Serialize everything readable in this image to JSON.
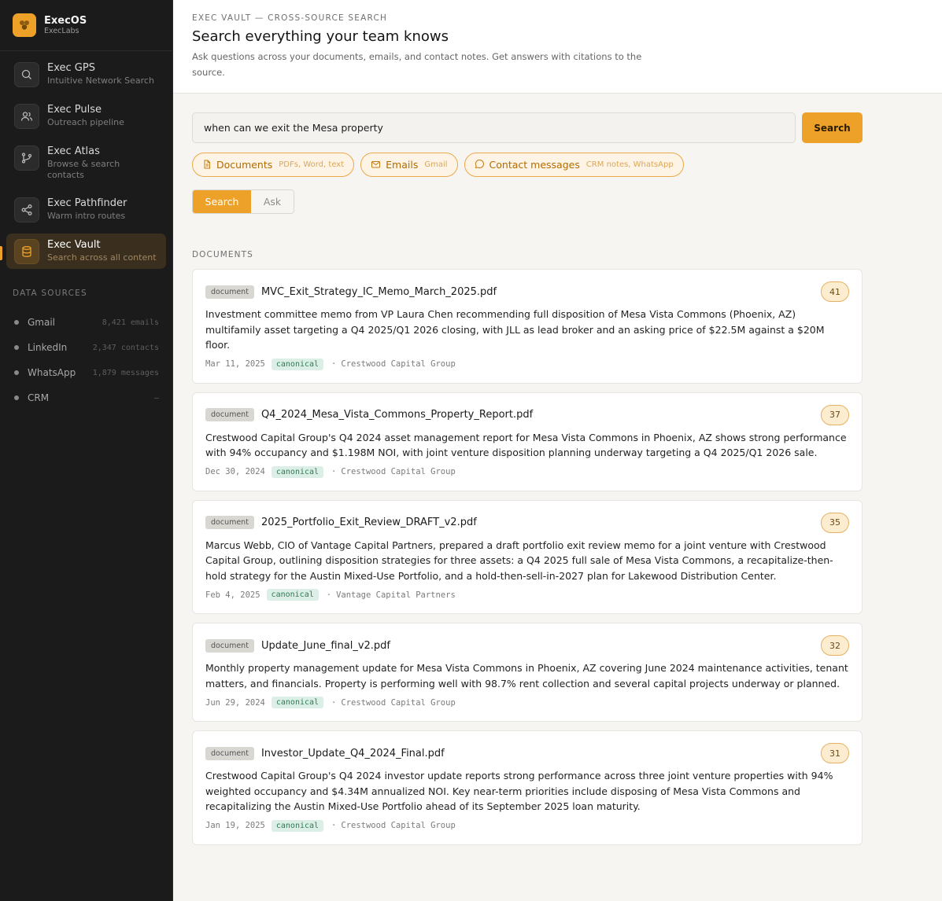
{
  "brand": {
    "name": "ExecOS",
    "org": "ExecLabs"
  },
  "nav": [
    {
      "title": "Exec GPS",
      "desc": "Intuitive Network Search",
      "icon": "search-icon"
    },
    {
      "title": "Exec Pulse",
      "desc": "Outreach pipeline",
      "icon": "users-icon"
    },
    {
      "title": "Exec Atlas",
      "desc": "Browse & search contacts",
      "icon": "git-branch-icon"
    },
    {
      "title": "Exec Pathfinder",
      "desc": "Warm intro routes",
      "icon": "share-icon"
    },
    {
      "title": "Exec Vault",
      "desc": "Search across all content",
      "icon": "database-icon",
      "active": true
    }
  ],
  "data_sources": {
    "heading": "DATA SOURCES",
    "items": [
      {
        "name": "Gmail",
        "count": "8,421 emails"
      },
      {
        "name": "LinkedIn",
        "count": "2,347 contacts"
      },
      {
        "name": "WhatsApp",
        "count": "1,879 messages"
      },
      {
        "name": "CRM",
        "count": "—"
      }
    ]
  },
  "header": {
    "eyebrow": "EXEC VAULT — CROSS-SOURCE SEARCH",
    "title": "Search everything your team knows",
    "subtitle": "Ask questions across your documents, emails, and contact notes. Get answers with citations to the source."
  },
  "search": {
    "value": "when can we exit the Mesa property",
    "button": "Search"
  },
  "filters": [
    {
      "label": "Documents",
      "hint": "PDFs, Word, text",
      "icon": "file-icon"
    },
    {
      "label": "Emails",
      "hint": "Gmail",
      "icon": "mail-icon"
    },
    {
      "label": "Contact messages",
      "hint": "CRM notes, WhatsApp",
      "icon": "message-icon"
    }
  ],
  "mode": {
    "search": "Search",
    "ask": "Ask"
  },
  "section": "DOCUMENTS",
  "results": [
    {
      "tag": "document",
      "file": "MVC_Exit_Strategy_IC_Memo_March_2025.pdf",
      "score": "41",
      "summary": "Investment committee memo from VP Laura Chen recommending full disposition of Mesa Vista Commons (Phoenix, AZ) multifamily asset targeting a Q4 2025/Q1 2026 closing, with JLL as lead broker and an asking price of $22.5M against a $20M floor.",
      "date": "Mar 11, 2025",
      "status": "canonical",
      "org": "Crestwood Capital Group"
    },
    {
      "tag": "document",
      "file": "Q4_2024_Mesa_Vista_Commons_Property_Report.pdf",
      "score": "37",
      "summary": "Crestwood Capital Group's Q4 2024 asset management report for Mesa Vista Commons in Phoenix, AZ shows strong performance with 94% occupancy and $1.198M NOI, with joint venture disposition planning underway targeting a Q4 2025/Q1 2026 sale.",
      "date": "Dec 30, 2024",
      "status": "canonical",
      "org": "Crestwood Capital Group"
    },
    {
      "tag": "document",
      "file": "2025_Portfolio_Exit_Review_DRAFT_v2.pdf",
      "score": "35",
      "summary": "Marcus Webb, CIO of Vantage Capital Partners, prepared a draft portfolio exit review memo for a joint venture with Crestwood Capital Group, outlining disposition strategies for three assets: a Q4 2025 full sale of Mesa Vista Commons, a recapitalize-then-hold strategy for the Austin Mixed-Use Portfolio, and a hold-then-sell-in-2027 plan for Lakewood Distribution Center.",
      "date": "Feb 4, 2025",
      "status": "canonical",
      "org": "Vantage Capital Partners"
    },
    {
      "tag": "document",
      "file": "Update_June_final_v2.pdf",
      "score": "32",
      "summary": "Monthly property management update for Mesa Vista Commons in Phoenix, AZ covering June 2024 maintenance activities, tenant matters, and financials. Property is performing well with 98.7% rent collection and several capital projects underway or planned.",
      "date": "Jun 29, 2024",
      "status": "canonical",
      "org": "Crestwood Capital Group"
    },
    {
      "tag": "document",
      "file": "Investor_Update_Q4_2024_Final.pdf",
      "score": "31",
      "summary": "Crestwood Capital Group's Q4 2024 investor update reports strong performance across three joint venture properties with 94% weighted occupancy and $4.34M annualized NOI. Key near-term priorities include disposing of Mesa Vista Commons and recapitalizing the Austin Mixed-Use Portfolio ahead of its September 2025 loan maturity.",
      "date": "Jan 19, 2025",
      "status": "canonical",
      "org": "Crestwood Capital Group"
    }
  ]
}
